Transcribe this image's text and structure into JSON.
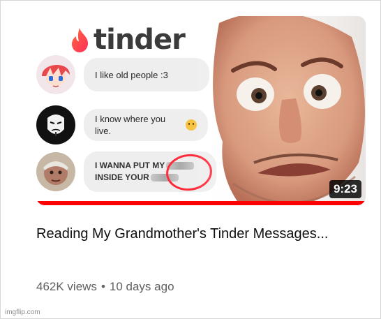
{
  "thumbnail": {
    "brand": "tinder",
    "messages": [
      {
        "avatar_icon": "anime-avatar-icon",
        "text": "I like old people :3"
      },
      {
        "avatar_icon": "anonymous-mask-avatar-icon",
        "text": "I know where you live.",
        "emoji": "smiley-icon"
      },
      {
        "avatar_icon": "grandmother-avatar-icon",
        "line1": "I WANNA PUT MY",
        "line2": "INSIDE YOUR"
      }
    ],
    "duration": "9:23",
    "watched_fraction": 1.0
  },
  "video": {
    "title": "Reading My Grandmother's Tinder Messages...",
    "views": "462K views",
    "separator": "•",
    "age": "10 days ago"
  },
  "watermark": "imgflip.com",
  "colors": {
    "brand_flame": "#fd2d5b",
    "progress": "#ff0000",
    "circle": "#ff2a3a"
  }
}
